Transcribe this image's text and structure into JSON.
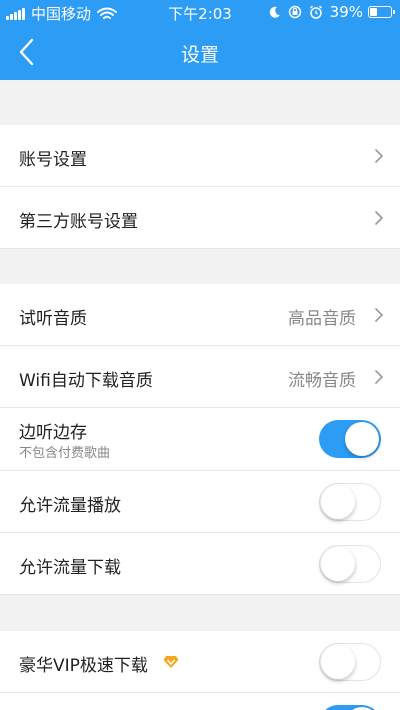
{
  "status_bar": {
    "carrier": "中国移动",
    "time": "下午2:03",
    "battery": "39%",
    "battery_level": 0.39,
    "icons": [
      "signal-icon",
      "wifi-icon",
      "moon-icon",
      "rotation-lock-icon",
      "alarm-icon",
      "battery-icon"
    ]
  },
  "nav": {
    "title": "设置",
    "back_icon": "back-chevron-icon"
  },
  "colors": {
    "accent": "#2d9cf5",
    "vip": "#f5a623"
  },
  "settings": {
    "account": "账号设置",
    "third_party_account": "第三方账号设置",
    "preview_quality": {
      "label": "试听音质",
      "value": "高品音质"
    },
    "wifi_download_quality": {
      "label": "Wifi自动下载音质",
      "value": "流畅音质"
    },
    "listen_and_save": {
      "label": "边听边存",
      "sub": "不包含付费歌曲",
      "enabled": true
    },
    "allow_data_playback": {
      "label": "允许流量播放",
      "enabled": false
    },
    "allow_data_download": {
      "label": "允许流量下载",
      "enabled": false
    },
    "vip_fast_download": {
      "label": "豪华VIP极速下载",
      "enabled": false,
      "icon": "vip-diamond-icon"
    }
  }
}
